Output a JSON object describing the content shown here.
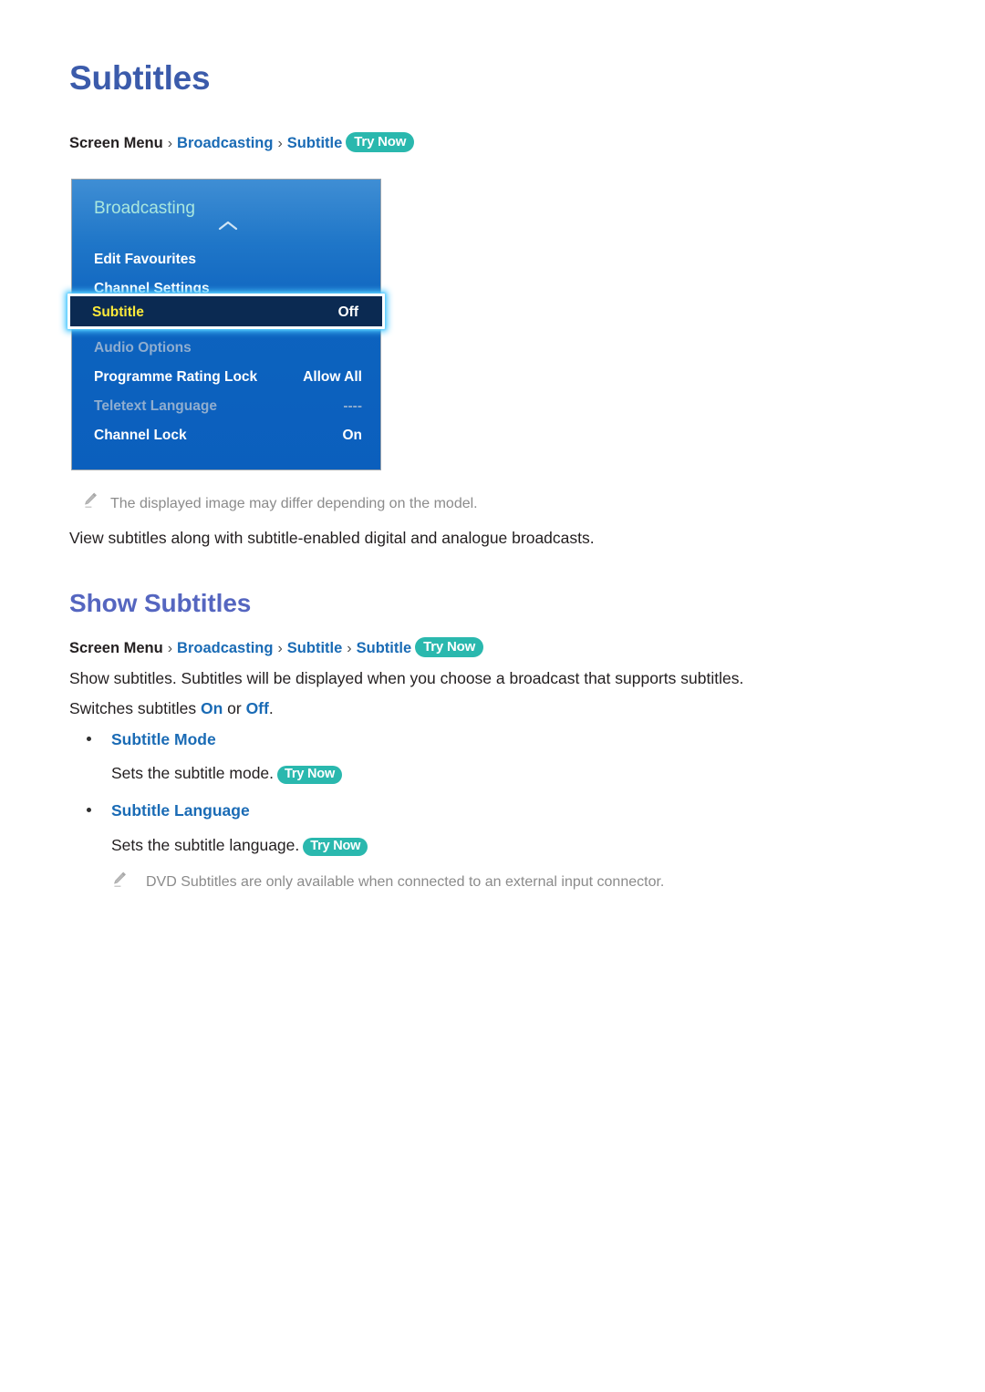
{
  "page": {
    "title": "Subtitles",
    "section_heading": "Show Subtitles"
  },
  "breadcrumb_top": {
    "root": "Screen Menu",
    "sep": "›",
    "item1": "Broadcasting",
    "item2": "Subtitle",
    "badge": "Try Now"
  },
  "breadcrumb_section": {
    "root": "Screen Menu",
    "sep": "›",
    "item1": "Broadcasting",
    "item2": "Subtitle",
    "item3": "Subtitle",
    "badge": "Try Now"
  },
  "tv_menu": {
    "title": "Broadcasting",
    "scroll_up_icon": "chevron-up-icon",
    "rows": [
      {
        "label": "Edit Favourites",
        "value": "",
        "state": "normal"
      },
      {
        "label": "Channel Settings",
        "value": "",
        "state": "normal"
      },
      {
        "label": "Subtitle",
        "value": "Off",
        "state": "selected"
      },
      {
        "label": "Audio Options",
        "value": "",
        "state": "disabled"
      },
      {
        "label": "Programme Rating Lock",
        "value": "Allow All",
        "state": "normal"
      },
      {
        "label": "Teletext Language",
        "value": "----",
        "state": "disabled"
      },
      {
        "label": "Channel Lock",
        "value": "On",
        "state": "normal"
      }
    ],
    "colors": {
      "panel_top": "#3f8ed4",
      "panel_bottom": "#0b5fbd",
      "title_text": "#a9e7de",
      "selected_bg": "#0b2a52",
      "selected_label": "#fbe93a",
      "selected_glow": "#4ac8ff",
      "disabled_text": "#8fadcf"
    }
  },
  "notes": [
    {
      "icon": "pencil-icon",
      "text": "The displayed image may differ depending on the model."
    },
    {
      "icon": "pencil-icon",
      "text": "DVD Subtitles are only available when connected to an external input connector."
    }
  ],
  "body": {
    "intro": "View subtitles along with subtitle-enabled digital and analogue broadcasts.",
    "desc_line1": "Show subtitles. Subtitles will be displayed when you choose a broadcast that supports subtitles.",
    "switch_prefix": "Switches subtitles ",
    "switch_on": "On",
    "switch_mid": " or ",
    "switch_off": "Off",
    "switch_suffix": "."
  },
  "options": [
    {
      "label": "Subtitle Mode",
      "description": "Sets the subtitle mode.",
      "badge": "Try Now"
    },
    {
      "label": "Subtitle Language",
      "description": "Sets the subtitle language.",
      "badge": "Try Now"
    }
  ],
  "colors": {
    "title_blue": "#3b5bab",
    "heading_blue": "#5566c0",
    "link_blue": "#1a6bb5",
    "badge_teal": "#2ab8ae",
    "body_text": "#231f20",
    "note_gray": "#8b8b8b"
  }
}
